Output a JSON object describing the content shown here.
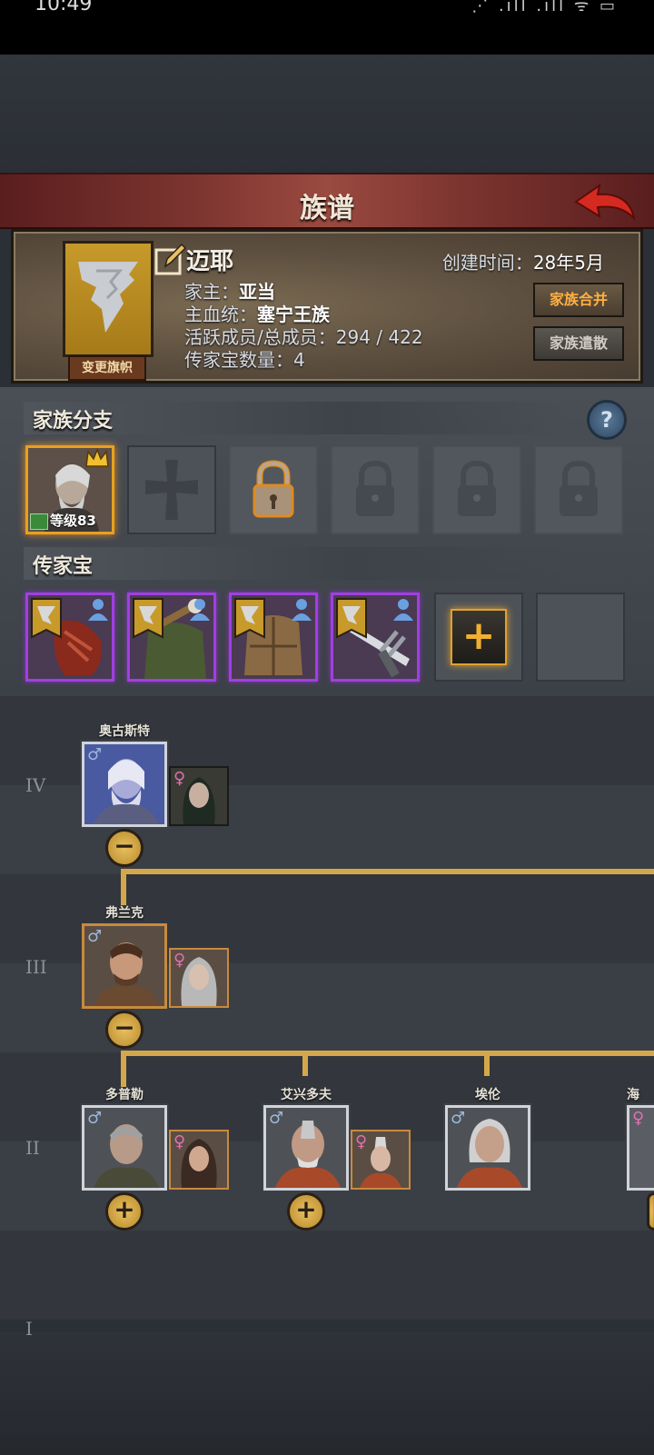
{
  "status_bar": {
    "time": "10:49",
    "icons": "⋰ .ıll .ıll ᯤ ▭"
  },
  "header": {
    "title": "族谱"
  },
  "family": {
    "name": "迈耶",
    "created_label": "创建时间：",
    "created_value": "28年5月",
    "change_flag_label": "变更旗帜",
    "head_label": "家主：",
    "head_value": "亚当",
    "bloodline_label": "主血统：",
    "bloodline_value": "塞宁王族",
    "members_label": "活跃成员/总成员：",
    "members_value": "294 / 422",
    "heirloom_count_label": "传家宝数量：",
    "heirloom_count_value": "4",
    "merge_button": "家族合并",
    "disband_button": "家族遣散"
  },
  "branches": {
    "title": "家族分支",
    "help": "?",
    "first_level": "等级83"
  },
  "heirlooms": {
    "title": "传家宝",
    "add": "+"
  },
  "tree": {
    "generations": [
      "IV",
      "III",
      "II",
      "I"
    ],
    "people": {
      "augustus": "奥古斯特",
      "frank": "弗兰克",
      "doppler": "多普勒",
      "aixingduofu": "艾兴多夫",
      "ailun": "埃伦",
      "partial": "海"
    },
    "collapse": "−",
    "expand": "+"
  }
}
